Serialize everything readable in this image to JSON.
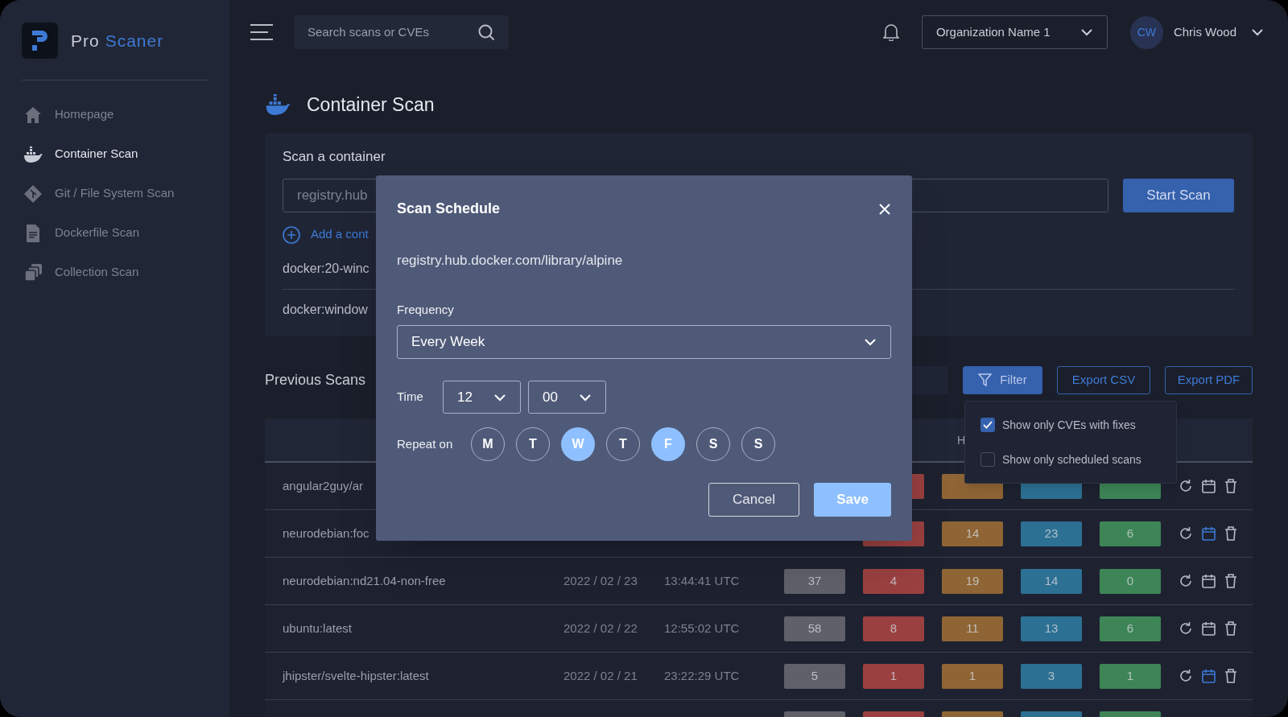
{
  "brand": {
    "prefix": "Pro",
    "highlight": "Scaner"
  },
  "sidebar": {
    "items": [
      {
        "label": "Homepage",
        "selected": false
      },
      {
        "label": "Container Scan",
        "selected": true
      },
      {
        "label": "Git / File System Scan",
        "selected": false
      },
      {
        "label": "Dockerfile Scan",
        "selected": false
      },
      {
        "label": "Collection Scan",
        "selected": false
      }
    ]
  },
  "search": {
    "placeholder": "Search scans or CVEs"
  },
  "organization": {
    "value": "Organization Name 1"
  },
  "user": {
    "initials": "CW",
    "name": "Chris Wood"
  },
  "page": {
    "title": "Container Scan"
  },
  "scan_card": {
    "title": "Scan a container",
    "input_placeholder": "registry.hub",
    "button": "Start Scan",
    "add_link": "Add a cont",
    "recent": [
      "docker:20-winc",
      "docker:window"
    ]
  },
  "previous_scans": {
    "title": "Previous Scans",
    "buttons": [
      {
        "label": "Filter",
        "kind": "primary"
      },
      {
        "label": "Export CSV",
        "kind": "outline"
      },
      {
        "label": "Export PDF",
        "kind": "outline"
      }
    ],
    "filter_menu": [
      {
        "label": "Show only CVEs with fixes",
        "checked": true
      },
      {
        "label": "Show only scheduled scans",
        "checked": false
      }
    ]
  },
  "table": {
    "column_header": "H",
    "rows": [
      {
        "name": "angular2guy/ar",
        "counts": [
          {
            "kind": "critical"
          },
          {
            "kind": "high"
          },
          {
            "kind": "medium"
          },
          {
            "kind": "low"
          }
        ],
        "scheduled": false
      },
      {
        "name": "neurodebian:foc",
        "counts": [
          {
            "kind": "critical"
          },
          {
            "kind": "high",
            "value": "14"
          },
          {
            "kind": "medium",
            "value": "23"
          },
          {
            "kind": "low",
            "value": "6"
          }
        ],
        "scheduled": true
      },
      {
        "name": "neurodebian:nd21.04-non-free",
        "date": "2022 / 02 / 23",
        "time": "13:44:41 UTC",
        "counts": [
          {
            "kind": "total",
            "value": "37"
          },
          {
            "kind": "critical",
            "value": "4"
          },
          {
            "kind": "high",
            "value": "19"
          },
          {
            "kind": "medium",
            "value": "14"
          },
          {
            "kind": "low",
            "value": "0"
          }
        ],
        "scheduled": false
      },
      {
        "name": "ubuntu:latest",
        "date": "2022 / 02 / 22",
        "time": "12:55:02 UTC",
        "counts": [
          {
            "kind": "total",
            "value": "58"
          },
          {
            "kind": "critical",
            "value": "8"
          },
          {
            "kind": "high",
            "value": "11"
          },
          {
            "kind": "medium",
            "value": "13"
          },
          {
            "kind": "low",
            "value": "6"
          }
        ],
        "scheduled": false
      },
      {
        "name": "jhipster/svelte-hipster:latest",
        "date": "2022 / 02 / 21",
        "time": "23:22:29 UTC",
        "counts": [
          {
            "kind": "total",
            "value": "5"
          },
          {
            "kind": "critical",
            "value": "1"
          },
          {
            "kind": "high",
            "value": "1"
          },
          {
            "kind": "medium",
            "value": "3"
          },
          {
            "kind": "low",
            "value": "1"
          }
        ],
        "scheduled": true
      },
      {
        "counts": [
          {
            "kind": "total"
          },
          {
            "kind": "critical"
          },
          {
            "kind": "high"
          },
          {
            "kind": "medium"
          },
          {
            "kind": "low"
          }
        ]
      }
    ]
  },
  "modal": {
    "title": "Scan Schedule",
    "target": "registry.hub.docker.com/library/alpine",
    "frequency_label": "Frequency",
    "frequency": "Every Week",
    "time_label": "Time",
    "hour": "12",
    "minute": "00",
    "repeat_label": "Repeat on",
    "days": [
      {
        "label": "M",
        "selected": false
      },
      {
        "label": "T",
        "selected": false
      },
      {
        "label": "W",
        "selected": true
      },
      {
        "label": "T",
        "selected": false
      },
      {
        "label": "F",
        "selected": true
      },
      {
        "label": "S",
        "selected": false
      },
      {
        "label": "S",
        "selected": false
      }
    ],
    "cancel": "Cancel",
    "save": "Save"
  }
}
